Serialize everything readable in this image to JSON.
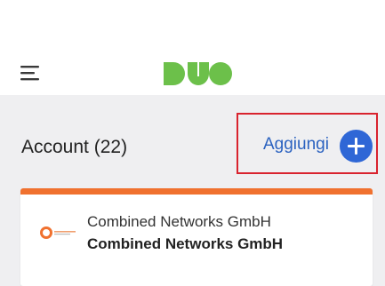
{
  "header": {
    "menu_icon": "hamburger-menu-icon",
    "logo": {
      "text": "DUO",
      "color": "#6cc04a"
    }
  },
  "accounts": {
    "title": "Account (22)",
    "add_label": "Aggiungi",
    "add_icon": "plus-icon",
    "highlight_color": "#d9232e",
    "link_color": "#2b62c0"
  },
  "account_card": {
    "accent_color": "#f0712f",
    "logo_icon": "combined-networks-logo",
    "organization": "Combined Networks GmbH",
    "name": "Combined Networks GmbH"
  }
}
